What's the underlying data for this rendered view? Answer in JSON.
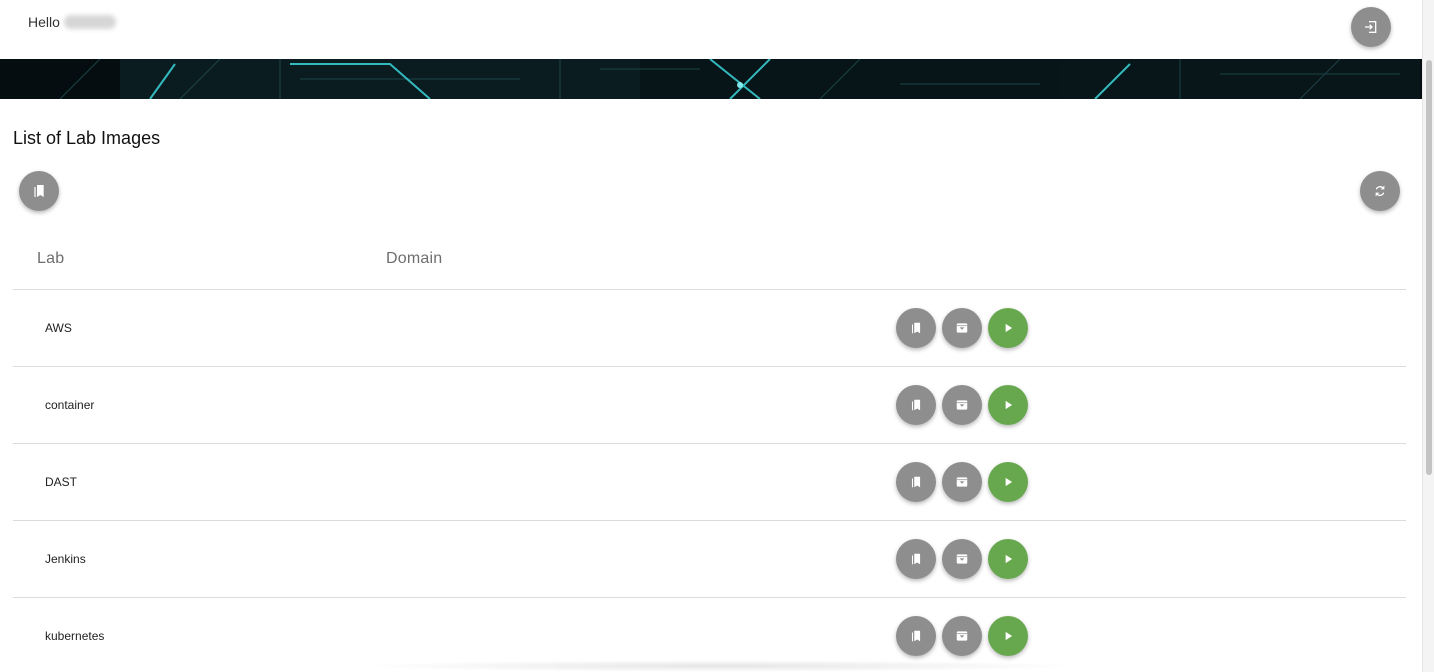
{
  "header": {
    "greeting": "Hello",
    "logout_icon": "exit-to-app-icon"
  },
  "main": {
    "title": "List of Lab Images",
    "add_icon": "bookmark-copy-icon",
    "refresh_icon": "refresh-icon"
  },
  "table": {
    "columns": {
      "lab": "Lab",
      "domain": "Domain"
    },
    "rows": [
      {
        "lab": "AWS",
        "domain": ""
      },
      {
        "lab": "container",
        "domain": ""
      },
      {
        "lab": "DAST",
        "domain": ""
      },
      {
        "lab": "Jenkins",
        "domain": ""
      },
      {
        "lab": "kubernetes",
        "domain": ""
      }
    ],
    "row_action_icons": [
      "bookmark-copy-icon",
      "archive-icon",
      "play-icon"
    ]
  },
  "colors": {
    "button_gray": "#8e8e8e",
    "play_green": "#67a84e",
    "banner_cyan": "#39e0e6"
  }
}
